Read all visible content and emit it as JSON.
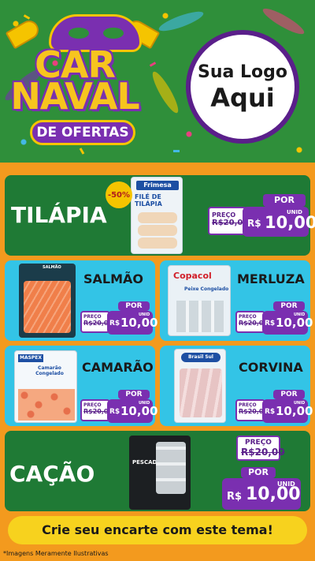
{
  "header": {
    "title_line1": "CAR",
    "title_line2": "NAVAL",
    "subtitle": "DE OFERTAS",
    "logo_line1": "Sua Logo",
    "logo_line2": "Aqui"
  },
  "colors": {
    "green": "#1f7a35",
    "cyan": "#33c4e6",
    "purple": "#7a2fb0",
    "yellow": "#f7d21e",
    "orange": "#f39a1e"
  },
  "discount_badge": "-50%",
  "products": {
    "tilapia": {
      "name": "TILÁPIA",
      "brand": "Frimesa",
      "package_text": "FILÉ DE TILÁPIA",
      "preco_label": "PREÇO",
      "old_price": "R$20,00",
      "por_label": "POR",
      "currency": "R$",
      "price": "10,00",
      "unit": "UNID"
    },
    "salmao": {
      "name": "SALMÃO",
      "package_text": "SALMÃO",
      "preco_label": "PREÇO",
      "old_price": "R$20,00",
      "por_label": "POR",
      "currency": "R$",
      "price": "10,00",
      "unit": "UNID"
    },
    "merluza": {
      "name": "MERLUZA",
      "brand": "Copacol",
      "package_text": "Peixe Congelado",
      "preco_label": "PREÇO",
      "old_price": "R$20,00",
      "por_label": "POR",
      "currency": "R$",
      "price": "10,00",
      "unit": "UNID"
    },
    "camarao": {
      "name": "CAMARÃO",
      "brand": "MASPEX",
      "package_text": "Camarão Congelado",
      "preco_label": "PREÇO",
      "old_price": "R$20,00",
      "por_label": "POR",
      "currency": "R$",
      "price": "10,00",
      "unit": "UNID"
    },
    "corvina": {
      "name": "CORVINA",
      "brand": "Brasil Sul",
      "preco_label": "PREÇO",
      "old_price": "R$20,00",
      "por_label": "POR",
      "currency": "R$",
      "price": "10,00",
      "unit": "UNID"
    },
    "cacao": {
      "name": "CAÇÃO",
      "package_text": "PESCADOS",
      "preco_label": "PREÇO",
      "old_price": "R$20,00",
      "por_label": "POR",
      "currency": "R$",
      "price": "10,00",
      "unit": "UNID"
    }
  },
  "cta": "Crie seu encarte com este tema!",
  "disclaimer": "*Imagens Meramente Ilustrativas"
}
